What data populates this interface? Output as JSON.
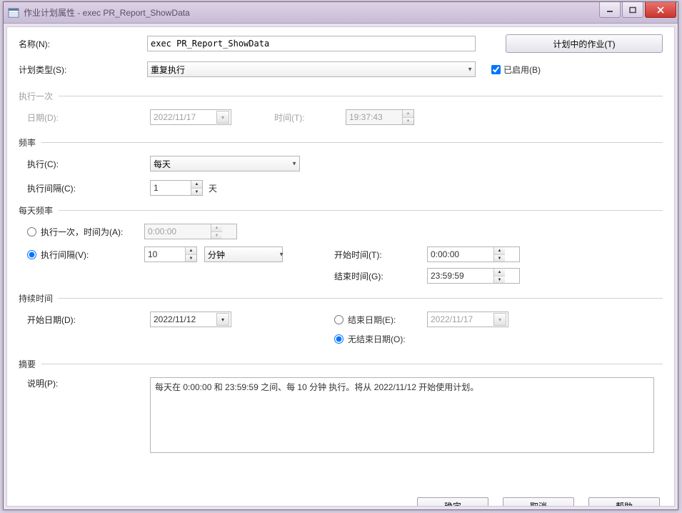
{
  "window": {
    "title": "作业计划属性 - exec PR_Report_ShowData"
  },
  "header": {
    "nameLabel": "名称(N):",
    "nameValue": "exec PR_Report_ShowData",
    "jobsInPlanButton": "计划中的作业(T)",
    "planTypeLabel": "计划类型(S):",
    "planTypeValue": "重复执行",
    "enabledLabel": "已启用(B)"
  },
  "execOnce": {
    "legend": "执行一次",
    "dateLabel": "日期(D):",
    "dateValue": "2022/11/17",
    "timeLabel": "时间(T):",
    "timeValue": "19:37:43"
  },
  "frequency": {
    "legend": "频率",
    "occursLabel": "执行(C):",
    "occursValue": "每天",
    "intervalLabel": "执行间隔(C):",
    "intervalValue": "1",
    "intervalUnit": "天"
  },
  "dailyFreq": {
    "legend": "每天频率",
    "onceAtLabel": "执行一次，时间为(A):",
    "onceAtValue": "0:00:00",
    "everyLabel": "执行间隔(V):",
    "everyValue": "10",
    "everyUnit": "分钟",
    "startLabel": "开始时间(T):",
    "startValue": "0:00:00",
    "endLabel": "结束时间(G):",
    "endValue": "23:59:59"
  },
  "duration": {
    "legend": "持续时间",
    "startDateLabel": "开始日期(D):",
    "startDateValue": "2022/11/12",
    "endDateLabel": "结束日期(E):",
    "endDateValue": "2022/11/17",
    "noEndDateLabel": "无结束日期(O):"
  },
  "summary": {
    "legend": "摘要",
    "descLabel": "说明(P):",
    "descValue": "每天在 0:00:00 和 23:59:59 之间、每 10 分钟 执行。将从 2022/11/12 开始使用计划。"
  },
  "buttons": {
    "ok": "确定",
    "cancel": "取消",
    "help": "帮助"
  }
}
